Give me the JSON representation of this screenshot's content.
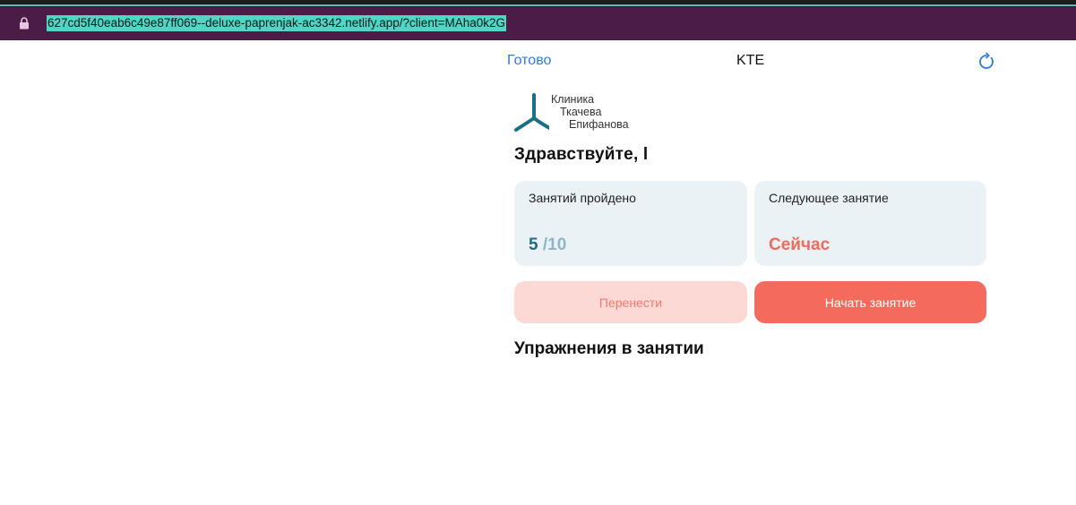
{
  "browser": {
    "url": "627cd5f40eab6c49e87ff069--deluxe-paprenjak-ac3342.netlify.app/?client=MAha0k2G"
  },
  "nav": {
    "done_label": "Готово",
    "title": "KTE"
  },
  "logo": {
    "line1": "Клиника",
    "line2": "Ткачева",
    "line3": "Епифанова"
  },
  "greeting": "Здравствуйте, l",
  "cards": {
    "completed": {
      "label": "Занятий пройдено",
      "done": "5",
      "total": "/10"
    },
    "next": {
      "label": "Следующее занятие",
      "value": "Сейчас"
    }
  },
  "buttons": {
    "reschedule": "Перенести",
    "start": "Начать занятие"
  },
  "section_title": "Упражнения в занятии",
  "colors": {
    "accent_blue": "#2b7de0",
    "teal": "#1b6e84",
    "coral": "#f46a5c",
    "card_bg": "#ebf2f6",
    "url_bar": "#4b1c46"
  }
}
